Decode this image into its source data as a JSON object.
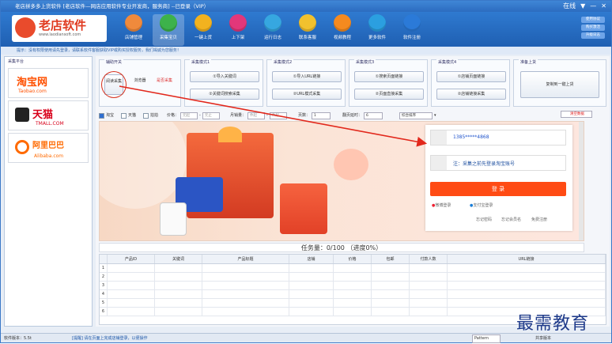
{
  "window": {
    "title": "老店拼多多上货软件 [老店软件—网店应用软件专业开发商，服务商] --已登录（VIP）",
    "ctrl": [
      "在线",
      "▼",
      "—",
      "✕"
    ]
  },
  "logo": {
    "name": "老店软件",
    "url": "www.laodiansoft.com"
  },
  "toolbar": {
    "items": [
      "店铺管理",
      "采集宝贝",
      "一键上货",
      "上下架",
      "运行日志",
      "联系客服",
      "视频教程",
      "更多软件",
      "软件注册"
    ],
    "right": [
      "使用协议",
      "购买激活",
      "升级日志"
    ],
    "colors": [
      "#f08a3c",
      "#3db24b",
      "#f2b21f",
      "#e2377a",
      "#36a7e0",
      "#f1c12e",
      "#f58a1f",
      "#2b9fe0",
      "#2b7ad8"
    ]
  },
  "notice": "提示：没有权限使用请先登录，请联系软件客服获取VIP或购买授权服务，我们竭诚为您服务！",
  "sidebar": {
    "header": "采集平台",
    "platforms": [
      {
        "t1": "淘宝网",
        "t2": "Taobao.com",
        "color": "#ff5000"
      },
      {
        "t1": "天猫",
        "t2": "TMALL.COM",
        "color": "#d8001a"
      },
      {
        "t1": "阿里巴巴",
        "t2": "Alibaba.com",
        "color": "#ff6a00"
      }
    ]
  },
  "groups": {
    "aux": {
      "title": "辅助开关",
      "b1": "阅读采集",
      "b2": "浏览器",
      "b3": "是否采集"
    },
    "mode1": {
      "title": "采集模式1",
      "b1": "①导入关键词",
      "b2": "②关键词搜索采集"
    },
    "mode2": {
      "title": "采集模式2",
      "b1": "①导入URL链接",
      "b2": "②URL模式采集"
    },
    "mode3": {
      "title": "采集模式3",
      "b1": "①搜索页面链接",
      "b2": "②页面直接采集"
    },
    "mode4": {
      "title": "采集模式4",
      "b1": "①店铺页面链接",
      "b2": "②店铺链接采集"
    },
    "upload": {
      "title": "准备上货",
      "b1": "复制到一键上货"
    }
  },
  "options": {
    "taobao": "淘宝",
    "tmall": "天猫",
    "alibaba": "拍拍",
    "price": "价格：",
    "price_ph": "元起",
    "price_to": "元止",
    "sales": "月销量：",
    "sales_ph": "件起",
    "pages": "页数：",
    "pages_val": "1",
    "interval": "翻页延时：",
    "interval_val": "6",
    "sort": "综合排序",
    "clear": "清空数据"
  },
  "login": {
    "user": "1385*****4868",
    "hint": "注：采集之前先登录淘宝账号",
    "button": "登 录",
    "wechat": "微博登录",
    "alipay": "支付宝登录",
    "links": [
      "忘记密码",
      "忘记会员名",
      "免费注册"
    ]
  },
  "task": {
    "label": "任务量：0/100",
    "progress": "（进度0%）"
  },
  "table": {
    "headers": [
      "",
      "产品ID",
      "关键词",
      "产品标题",
      "店铺",
      "价格",
      "包邮",
      "付款人数",
      "URL链接"
    ],
    "rows": [
      "1",
      "2",
      "3",
      "4",
      "5",
      "6"
    ]
  },
  "status": {
    "version": "软件版本：5.5t",
    "msg": "[提醒] 请在页面上完成店铺登录，以便操作",
    "pattern": "Pattern",
    "shared": "共享版本"
  },
  "watermark": "最需教育"
}
